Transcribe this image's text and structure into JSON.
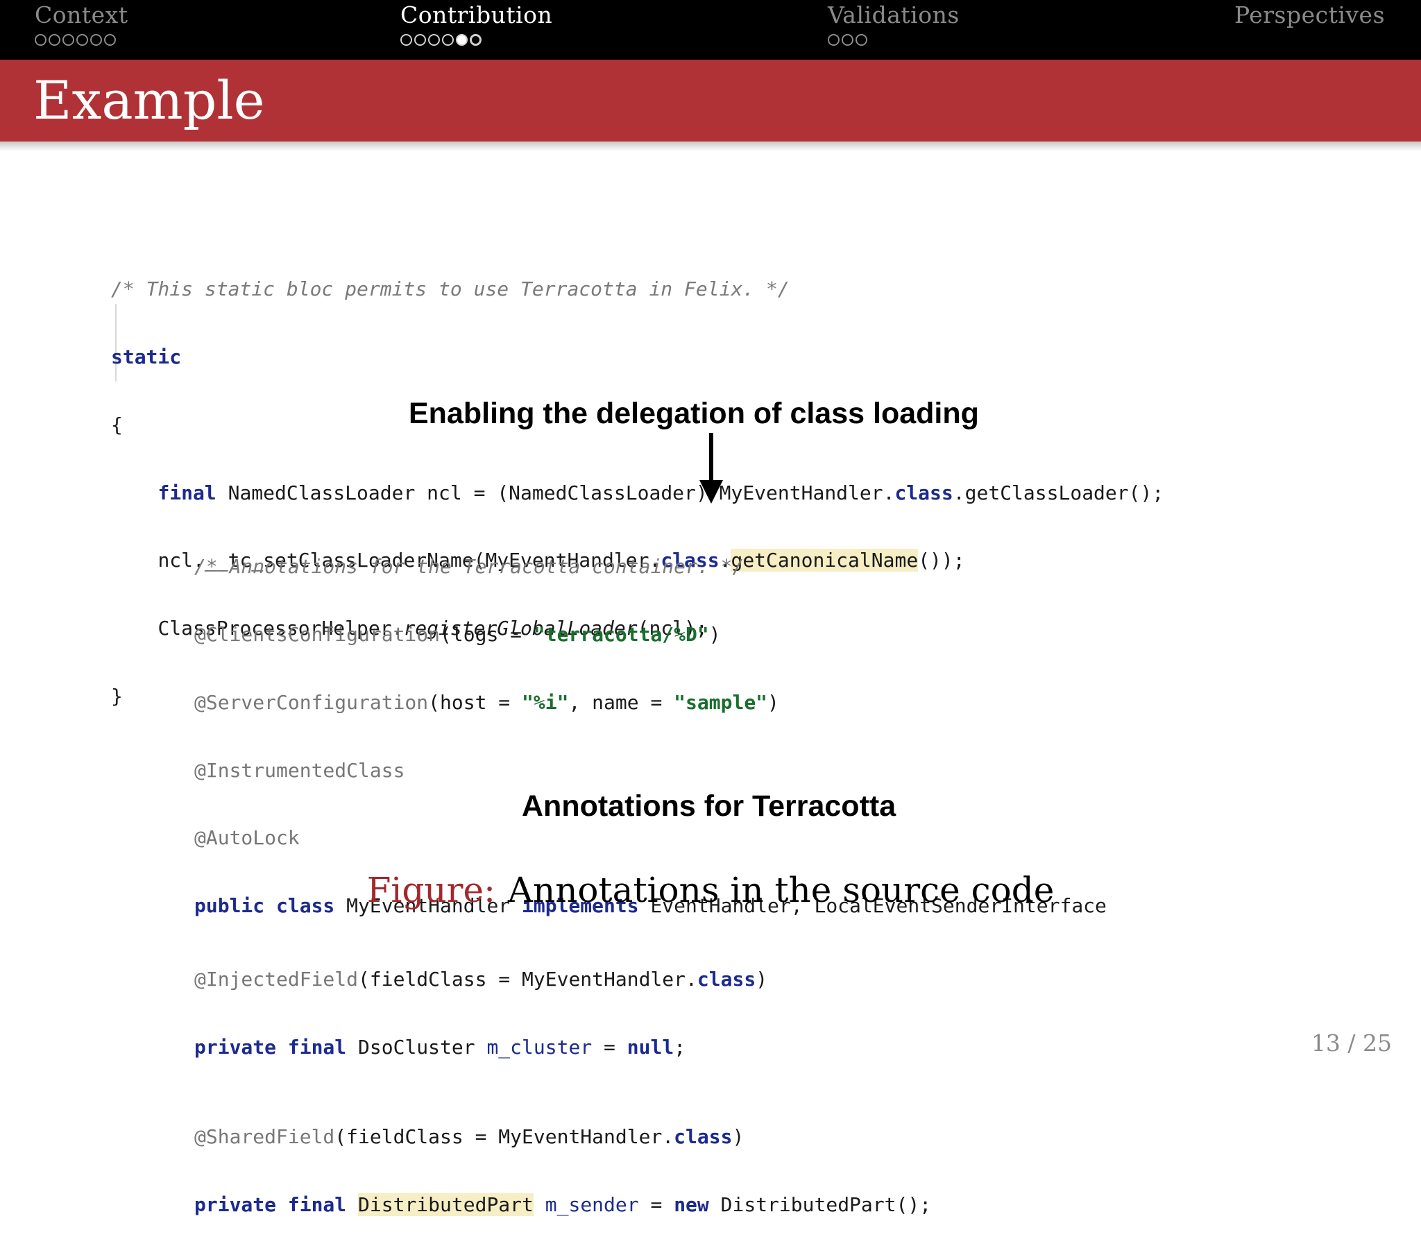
{
  "nav": {
    "sections": [
      {
        "title": "Context",
        "dots": [
          0,
          0,
          0,
          0,
          0,
          0
        ],
        "active": false
      },
      {
        "title": "Contribution",
        "dots": [
          0,
          0,
          0,
          0,
          1,
          2
        ],
        "active": true
      },
      {
        "title": "Validations",
        "dots": [
          0,
          0,
          0
        ],
        "active": false
      },
      {
        "title": "Perspectives",
        "dots": [],
        "active": false
      }
    ]
  },
  "slide": {
    "title": "Example",
    "page_number": "13 / 25"
  },
  "code_block_1": {
    "comment": "/* This static bloc permits to use Terracotta in Felix. */",
    "static_kw": "static",
    "open_brace": "{",
    "line1": {
      "final_kw": "final",
      "text1": " NamedClassLoader ncl = (NamedClassLoader) MyEventHandler.",
      "class_kw": "class",
      "text2": ".getClassLoader();"
    },
    "line2": {
      "text1": "ncl.__tc_setClassLoaderName(MyEventHandler.",
      "class_kw": "class",
      "dot": ".",
      "highlight": "getCanonicalName",
      "text2": "());"
    },
    "line3": {
      "text1": "ClassProcessorHelper.",
      "italic": "registerGlobalLoader",
      "text2": "(ncl);"
    },
    "close_brace": "}"
  },
  "caption_top": "Enabling the delegation of class loading",
  "code_block_2": {
    "comment": "/* Annotations for the Terracotta container. */",
    "l1": {
      "ann": "@ClientsConfiguration",
      "t1": "(logs = ",
      "str": "\"terracotta/%D\"",
      "t2": ")"
    },
    "l2": {
      "ann": "@ServerConfiguration",
      "t1": "(host = ",
      "str1": "\"%i\"",
      "t2": ", name = ",
      "str2": "\"sample\"",
      "t3": ")"
    },
    "l3": {
      "ann": "@InstrumentedClass"
    },
    "l4": {
      "ann": "@AutoLock"
    },
    "l5": {
      "kw1": "public class",
      "t1": " MyEventHandler ",
      "kw2": "implements",
      "t2": " EventHandler, LocalEventSenderInterface"
    },
    "l6": {
      "ann": "@InjectedField",
      "t1": "(fieldClass = MyEventHandler.",
      "kw": "class",
      "t2": ")"
    },
    "l7": {
      "kw1": "private final",
      "t1": " DsoCluster ",
      "field": "m_cluster",
      "t2": " = ",
      "kw2": "null",
      "t3": ";"
    },
    "l8": {
      "ann": "@SharedField",
      "t1": "(fieldClass = MyEventHandler.",
      "kw": "class",
      "t2": ")"
    },
    "l9": {
      "kw1": "private final",
      "sp": " ",
      "highlight": "DistributedPart",
      "t1": " ",
      "field": "m_sender",
      "t2": " = ",
      "kw2": "new",
      "t3": " DistributedPart();"
    }
  },
  "caption_bottom": "Annotations for Terracotta",
  "figure": {
    "label": "Figure:",
    "text": "Annotations in the source code"
  },
  "colors": {
    "nav_bg": "#000000",
    "title_band": "#b03236",
    "figure_label": "#a3282d",
    "keyword": "#1c2a8f",
    "string": "#1a6e2e",
    "highlight": "#f6eec4"
  }
}
